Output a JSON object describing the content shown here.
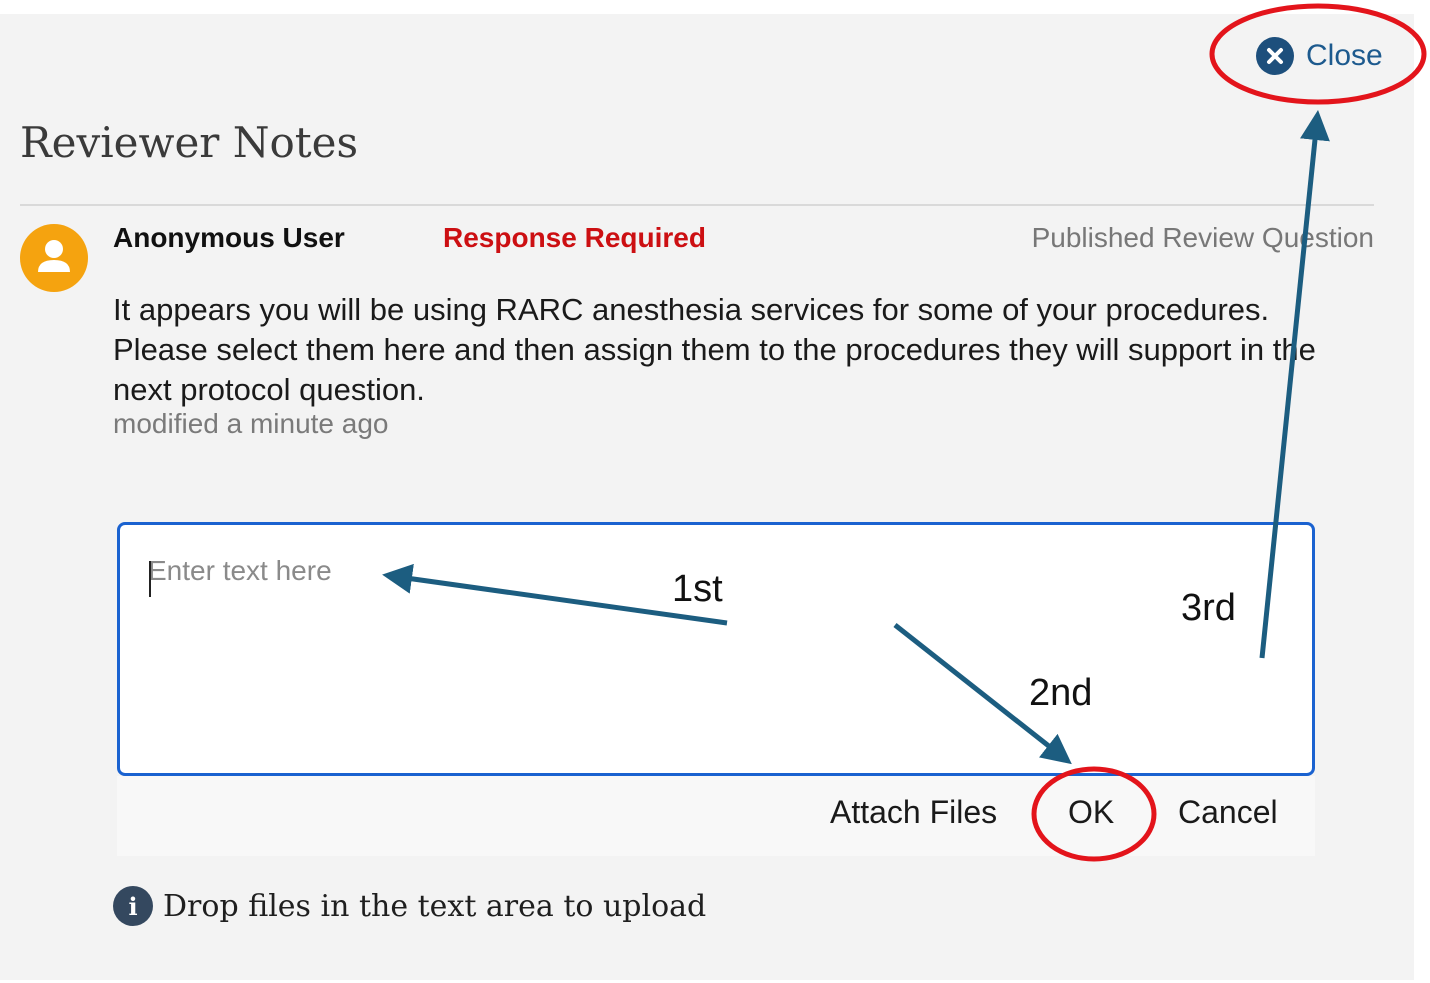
{
  "header": {
    "close_label": "Close",
    "title": "Reviewer Notes"
  },
  "note": {
    "author": "Anonymous User",
    "status": "Response Required",
    "source": "Published Review Question",
    "message": "It appears you will be using RARC anesthesia services for some of your procedures. Please select them here and then assign them to the procedures they will support in the next protocol question.",
    "modified": "modified a minute ago"
  },
  "reply": {
    "placeholder": "Enter text here",
    "attach_label": "Attach Files",
    "ok_label": "OK",
    "cancel_label": "Cancel"
  },
  "footer": {
    "info_text": "Drop files in the text area to upload"
  },
  "annotations": {
    "step1": "1st",
    "step2": "2nd",
    "step3": "3rd",
    "arrow_color": "#1c5d80",
    "highlight_color": "#e3141b"
  },
  "colors": {
    "panel_bg": "#f3f3f3",
    "status_red": "#cc0f12",
    "input_border": "#1a62d0",
    "avatar": "#f5a30f",
    "close_icon": "#1d4f7c"
  },
  "icons": {
    "close": "close-circle-icon",
    "avatar": "user-avatar-icon",
    "info": "info-icon"
  }
}
